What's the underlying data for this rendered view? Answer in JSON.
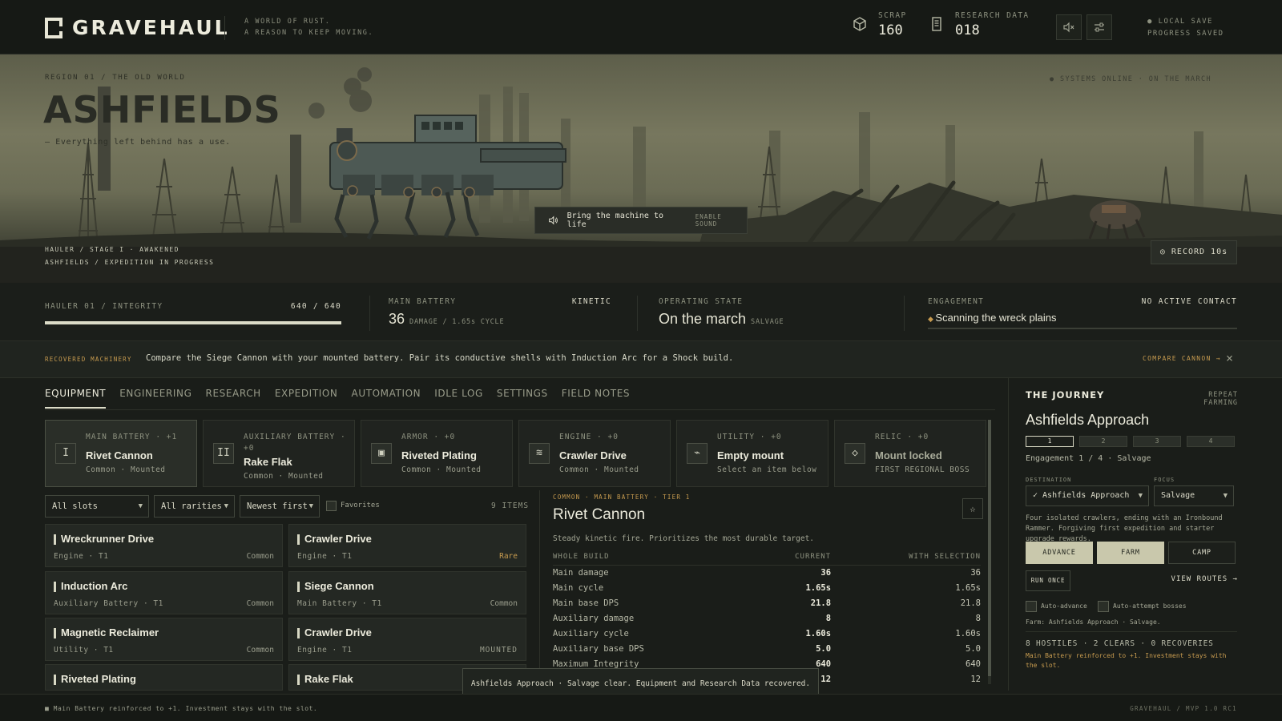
{
  "header": {
    "logo": "GRAVEHAUL",
    "tagline": [
      "A WORLD OF RUST.",
      "A REASON TO KEEP MOVING."
    ],
    "scrap": {
      "label": "SCRAP",
      "value": "160",
      "icon": "crate-icon"
    },
    "research": {
      "label": "RESEARCH DATA",
      "value": "018",
      "icon": "document-icon"
    },
    "save": {
      "line1": "● LOCAL SAVE",
      "line2": "PROGRESS SAVED"
    }
  },
  "hero": {
    "kicker": "REGION 01 / THE OLD WORLD",
    "title": "ASHFIELDS",
    "subtitle": "— Everything left behind has a use.",
    "status": "● SYSTEMS ONLINE · ON THE MARCH",
    "meta": [
      "HAULER / STAGE I · AWAKENED",
      "ASHFIELDS / EXPEDITION IN PROGRESS"
    ],
    "sound_label": "Bring the machine to life",
    "sound_sub": "ENABLE SOUND",
    "record_label": "RECORD 10s"
  },
  "stats": {
    "integrity": {
      "label": "HAULER 01 / INTEGRITY",
      "value": "640 / 640",
      "fraction": 1.0
    },
    "battery": {
      "label": "MAIN BATTERY",
      "type": "KINETIC",
      "value": "36",
      "unit": "DAMAGE / 1.65s CYCLE"
    },
    "state": {
      "label": "OPERATING STATE",
      "value": "On the march",
      "sub": "SALVAGE"
    },
    "engagement": {
      "label": "ENGAGEMENT",
      "status": "NO ACTIVE CONTACT",
      "value": "Scanning the wreck plains"
    }
  },
  "notice": {
    "kicker": "RECOVERED MACHINERY",
    "text": "Compare the Siege Cannon with your mounted battery. Pair its conductive shells with Induction Arc for a Shock build.",
    "link": "COMPARE CANNON →",
    "close": "×"
  },
  "tabs": [
    "EQUIPMENT",
    "ENGINEERING",
    "RESEARCH",
    "EXPEDITION",
    "AUTOMATION",
    "IDLE LOG",
    "SETTINGS",
    "FIELD NOTES"
  ],
  "slots": [
    {
      "label": "MAIN BATTERY · +1",
      "name": "Rivet Cannon",
      "meta": "Common · Mounted",
      "icon": "I"
    },
    {
      "label": "AUXILIARY BATTERY · +0",
      "name": "Rake Flak",
      "meta": "Common · Mounted",
      "icon": "II"
    },
    {
      "label": "ARMOR · +0",
      "name": "Riveted Plating",
      "meta": "Common · Mounted",
      "icon": "▣"
    },
    {
      "label": "ENGINE · +0",
      "name": "Crawler Drive",
      "meta": "Common · Mounted",
      "icon": "≋"
    },
    {
      "label": "UTILITY · +0",
      "name": "Empty mount",
      "meta": "Select an item below",
      "icon": "⌁"
    },
    {
      "label": "RELIC · +0",
      "name": "Mount locked",
      "meta": "FIRST REGIONAL BOSS",
      "icon": "◇"
    }
  ],
  "filters": {
    "slot": "All slots",
    "rarity": "All rarities",
    "sort": "Newest first",
    "favorites": "Favorites",
    "count": "9 ITEMS"
  },
  "items": [
    {
      "name": "Wreckrunner Drive",
      "meta": "Engine · T1",
      "rarity": "Common"
    },
    {
      "name": "Crawler Drive",
      "meta": "Engine · T1",
      "rarity": "Rare"
    },
    {
      "name": "Induction Arc",
      "meta": "Auxiliary Battery · T1",
      "rarity": "Common"
    },
    {
      "name": "Siege Cannon",
      "meta": "Main Battery · T1",
      "rarity": "Common"
    },
    {
      "name": "Magnetic Reclaimer",
      "meta": "Utility · T1",
      "rarity": "Common"
    },
    {
      "name": "Crawler Drive",
      "meta": "Engine · T1",
      "rarity": "MOUNTED"
    },
    {
      "name": "Riveted Plating",
      "meta": "",
      "rarity": ""
    },
    {
      "name": "Rake Flak",
      "meta": "",
      "rarity": ""
    }
  ],
  "detail": {
    "kicker": "COMMON · MAIN BATTERY · TIER 1",
    "title": "Rivet Cannon",
    "desc": "Steady kinetic fire. Prioritizes the most durable target.",
    "cols": [
      "WHOLE BUILD",
      "CURRENT",
      "WITH SELECTION"
    ],
    "rows": [
      [
        "Main damage",
        "36",
        "36"
      ],
      [
        "Main cycle",
        "1.65s",
        "1.65s"
      ],
      [
        "Main base DPS",
        "21.8",
        "21.8"
      ],
      [
        "Auxiliary damage",
        "8",
        "8"
      ],
      [
        "Auxiliary cycle",
        "1.60s",
        "1.60s"
      ],
      [
        "Auxiliary base DPS",
        "5.0",
        "5.0"
      ],
      [
        "Maximum Integrity",
        "640",
        "640"
      ],
      [
        "",
        "12",
        "12"
      ]
    ]
  },
  "journey": {
    "title": "THE JOURNEY",
    "repeat": "REPEAT FARMING",
    "name": "Ashfields Approach",
    "stages": [
      "1",
      "2",
      "3",
      "4"
    ],
    "engagement": "Engagement 1 / 4 · Salvage",
    "destination_label": "DESTINATION",
    "destination": "✓ Ashfields Approach",
    "focus_label": "FOCUS",
    "focus": "Salvage",
    "desc": "Four isolated crawlers, ending with an Ironbound Rammer. Forgiving first expedition and starter upgrade rewards.",
    "actions": [
      "ADVANCE",
      "FARM",
      "CAMP"
    ],
    "run_once": "RUN ONCE",
    "view_routes": "VIEW ROUTES →",
    "auto_advance": "Auto-advance",
    "auto_boss": "Auto-attempt bosses",
    "farm": "Farm: Ashfields Approach · Salvage.",
    "counts": "8 HOSTILES · 2 CLEARS · 0 RECOVERIES",
    "log": "Main Battery reinforced to +1. Investment stays with the slot."
  },
  "toast": "Ashfields Approach · Salvage clear. Equipment and Research Data recovered.",
  "footer": {
    "msg": "■ Main Battery reinforced to +1. Investment stays with the slot.",
    "version": "GRAVEHAUL   /   MVP 1.0 RC1"
  }
}
